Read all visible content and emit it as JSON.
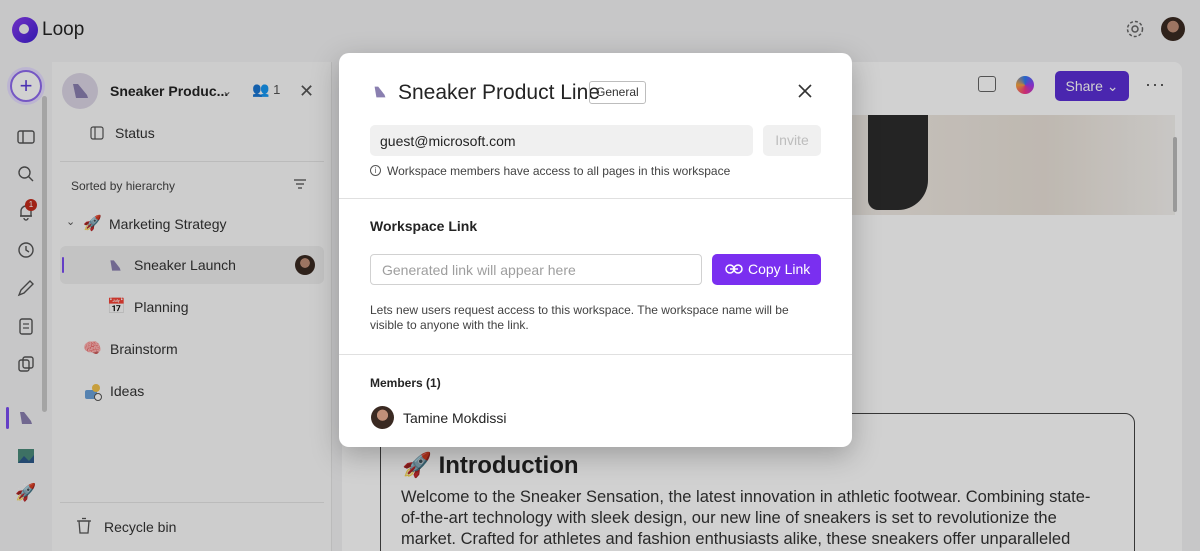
{
  "app": {
    "name": "Loop"
  },
  "sidebar": {
    "workspace_title": "Sneaker Produc...",
    "member_count": "1",
    "status_label": "Status",
    "sorted_label": "Sorted by hierarchy",
    "tree": [
      {
        "label": "Marketing Strategy",
        "emoji": "🚀"
      },
      {
        "label": "Sneaker Launch"
      },
      {
        "label": "Planning",
        "emoji": "📅"
      },
      {
        "label": "Brainstorm",
        "emoji": "🧠"
      },
      {
        "label": "Ideas"
      }
    ],
    "recycle_label": "Recycle bin"
  },
  "rail": {
    "notification_count": "1"
  },
  "page": {
    "share_label": "Share",
    "intro_emoji": "🚀",
    "intro_title": "Introduction",
    "intro_body": "Welcome to the Sneaker Sensation, the latest innovation in athletic footwear. Combining state-of-the-art technology with sleek design, our new line of sneakers is set to revolutionize the market. Crafted for athletes and fashion enthusiasts alike, these sneakers offer unparalleled comfort, durability, and style."
  },
  "modal": {
    "title": "Sneaker Product Line",
    "badge": "General",
    "email_value": "guest@microsoft.com",
    "invite_label": "Invite",
    "info_text": "Workspace members have access to all pages in this workspace",
    "workspace_link_heading": "Workspace Link",
    "link_placeholder": "Generated link will appear here",
    "copy_link_label": "Copy Link",
    "link_description": "Lets new users request access to this workspace. The workspace name will be visible to anyone with the link.",
    "members_heading": "Members (1)",
    "members": [
      {
        "name": "Tamine Mokdissi"
      }
    ]
  },
  "colors": {
    "accent": "#7a2ff0",
    "share": "#5b2fd6",
    "badge_red": "#c42b1c"
  },
  "icons": [
    "gear-icon",
    "add-icon",
    "sidebar-icon",
    "search-icon",
    "bell-icon",
    "clock-icon",
    "pen-icon",
    "notes-icon",
    "copilot-icon",
    "close-icon",
    "info-icon",
    "link-icon",
    "filter-icon",
    "trash-icon"
  ]
}
